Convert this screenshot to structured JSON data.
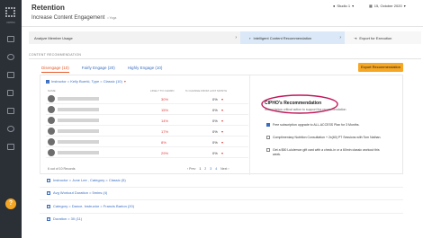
{
  "sidebar": {
    "brand_label": "CIPHO",
    "items": [
      "",
      "",
      "",
      "",
      "",
      "",
      ""
    ],
    "help_label": "?"
  },
  "header": {
    "app_title": "Retention",
    "page_subtitle": "Increase Content Engagement",
    "subtitle_tag": "• Yoga",
    "studio": "Studio 1",
    "date": "15, October 2020"
  },
  "steps": [
    {
      "label": "Analyze Member Usage"
    },
    {
      "label": "Intelligent Content Recommendation"
    },
    {
      "label": "Export for Execution"
    }
  ],
  "section_label": "CONTENT RECOMMENDATION",
  "tabs": [
    {
      "label": "Disengage (10)"
    },
    {
      "label": "Fairly Engage (20)"
    },
    {
      "label": "Highly Engage (10)"
    }
  ],
  "export_button": "Export Recommendation",
  "panel": {
    "title": "Instructor = Kelly Buerki, Type = Classic (10)",
    "columns": {
      "name": "NAME",
      "churn": "LIKELY TO CHURN",
      "change": "% CHANGE FROM LAST MONTH"
    },
    "rows": [
      {
        "churn": "30%",
        "change": "0%"
      },
      {
        "churn": "15%",
        "change": "0%"
      },
      {
        "churn": "14%",
        "change": "0%"
      },
      {
        "churn": "17%",
        "change": "0%"
      },
      {
        "churn": "8%",
        "change": "0%"
      },
      {
        "churn": "29%",
        "change": "0%"
      }
    ],
    "pager_left": "6 out of 10 Records",
    "pager_prev": "Prev",
    "pages": [
      "1",
      "2",
      "3",
      "4"
    ],
    "pager_next": "Next",
    "recommendation": {
      "title": "CIPHO's Recommendation",
      "subtitle": "Select below critical action to support the recommendation",
      "items": [
        {
          "text": "Free subscription upgrade to ALL-ACCESS Plan for 3 Months.",
          "checked": true
        },
        {
          "text": "Complimentary Nutrition Consultation + 2x(60) PT Sessions with Tom Nathan.",
          "checked": false
        },
        {
          "text": "Get a $50 Lululemon gift card with a check-in or a 60min classic workout this week.",
          "checked": false
        }
      ]
    }
  },
  "groups": [
    {
      "label": "Instructor = June Lee , Category = Classic (5)"
    },
    {
      "label": "Avg Workout Duration = 5mins (4)"
    },
    {
      "label": "Category = Dance, Instructor = Francis Barton (20)"
    },
    {
      "label": "Duration = 30 (11)"
    }
  ],
  "colors": {
    "accent": "#f5a623",
    "link": "#3a6ec2",
    "danger": "#e03c3c",
    "sidebar": "#2b2f36"
  }
}
